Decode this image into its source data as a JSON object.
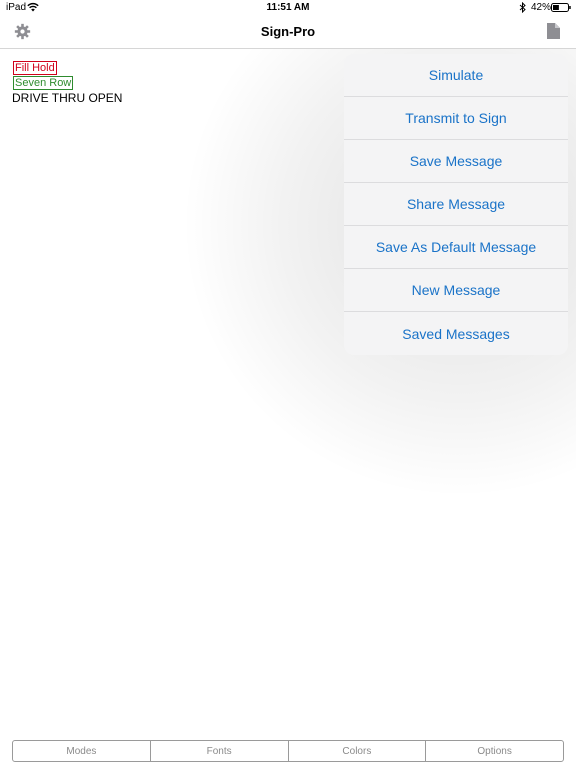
{
  "status_bar": {
    "carrier": "iPad",
    "time": "11:51 AM",
    "battery_percent": "42%",
    "battery_level": 0.42,
    "icons": [
      "wifi-icon",
      "bluetooth-icon",
      "battery-icon"
    ]
  },
  "nav": {
    "title": "Sign-Pro",
    "left_icon": "gear-icon",
    "right_icon": "document-icon"
  },
  "content": {
    "tags": [
      {
        "label": "Fill Hold",
        "color": "#d0021b"
      },
      {
        "label": "Seven Row",
        "color": "#2e8b2e"
      }
    ],
    "message": "DRIVE THRU OPEN"
  },
  "menu": {
    "accent": "#1a73c8",
    "items": [
      "Simulate",
      "Transmit to Sign",
      "Save Message",
      "Share Message",
      "Save As Default Message",
      "New Message",
      "Saved Messages"
    ]
  },
  "tabs": [
    "Modes",
    "Fonts",
    "Colors",
    "Options"
  ]
}
